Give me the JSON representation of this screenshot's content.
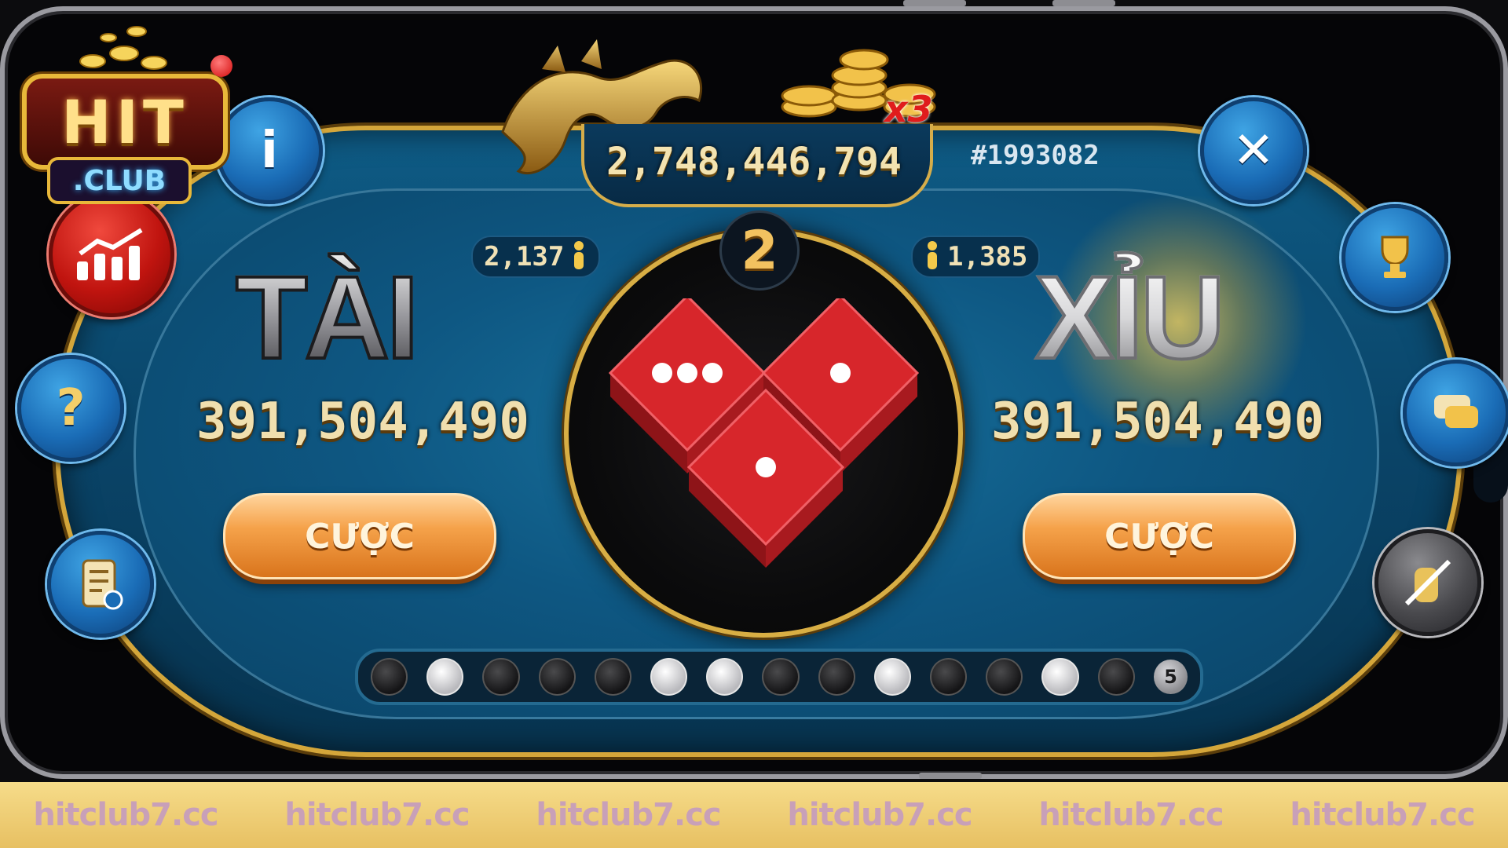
{
  "brand": {
    "logo_main": "HIT",
    "logo_sub": ".CLUB"
  },
  "jackpot": {
    "value": "2,748,446,794",
    "multiplier": "x3"
  },
  "session": {
    "id": "#1993082",
    "timer": "2"
  },
  "tai": {
    "title": "TÀI",
    "players": "2,137",
    "total_bet": "391,504,490",
    "bet_label": "CƯỢC"
  },
  "xiu": {
    "title": "XỈU",
    "players": "1,385",
    "total_bet": "391,504,490",
    "bet_label": "CƯỢC"
  },
  "dice": {
    "values": [
      3,
      1,
      1
    ],
    "color": "#d7262b"
  },
  "history": {
    "results": [
      "dark",
      "light",
      "dark",
      "dark",
      "dark",
      "light",
      "light",
      "dark",
      "dark",
      "light",
      "dark",
      "dark",
      "light",
      "dark"
    ],
    "last_label": "5"
  },
  "left_buttons": [
    {
      "icon": "info-icon",
      "glyph": "i"
    },
    {
      "icon": "chart-icon",
      "glyph": ""
    },
    {
      "icon": "help-icon",
      "glyph": "?"
    },
    {
      "icon": "rules-scroll-icon",
      "glyph": ""
    }
  ],
  "right_buttons": [
    {
      "icon": "close-icon",
      "glyph": "✕"
    },
    {
      "icon": "trophy-icon",
      "glyph": ""
    },
    {
      "icon": "chat-icon",
      "glyph": ""
    },
    {
      "icon": "hand-disabled-icon",
      "glyph": ""
    }
  ],
  "footer": {
    "watermarks": [
      "hitclub7.cc",
      "hitclub7.cc",
      "hitclub7.cc",
      "hitclub7.cc",
      "hitclub7.cc",
      "hitclub7.cc"
    ]
  },
  "colors": {
    "table": "#0e5b85",
    "gold": "#d4a63a",
    "bet_button": "#f5a24a",
    "footer": "#f0d27a"
  }
}
